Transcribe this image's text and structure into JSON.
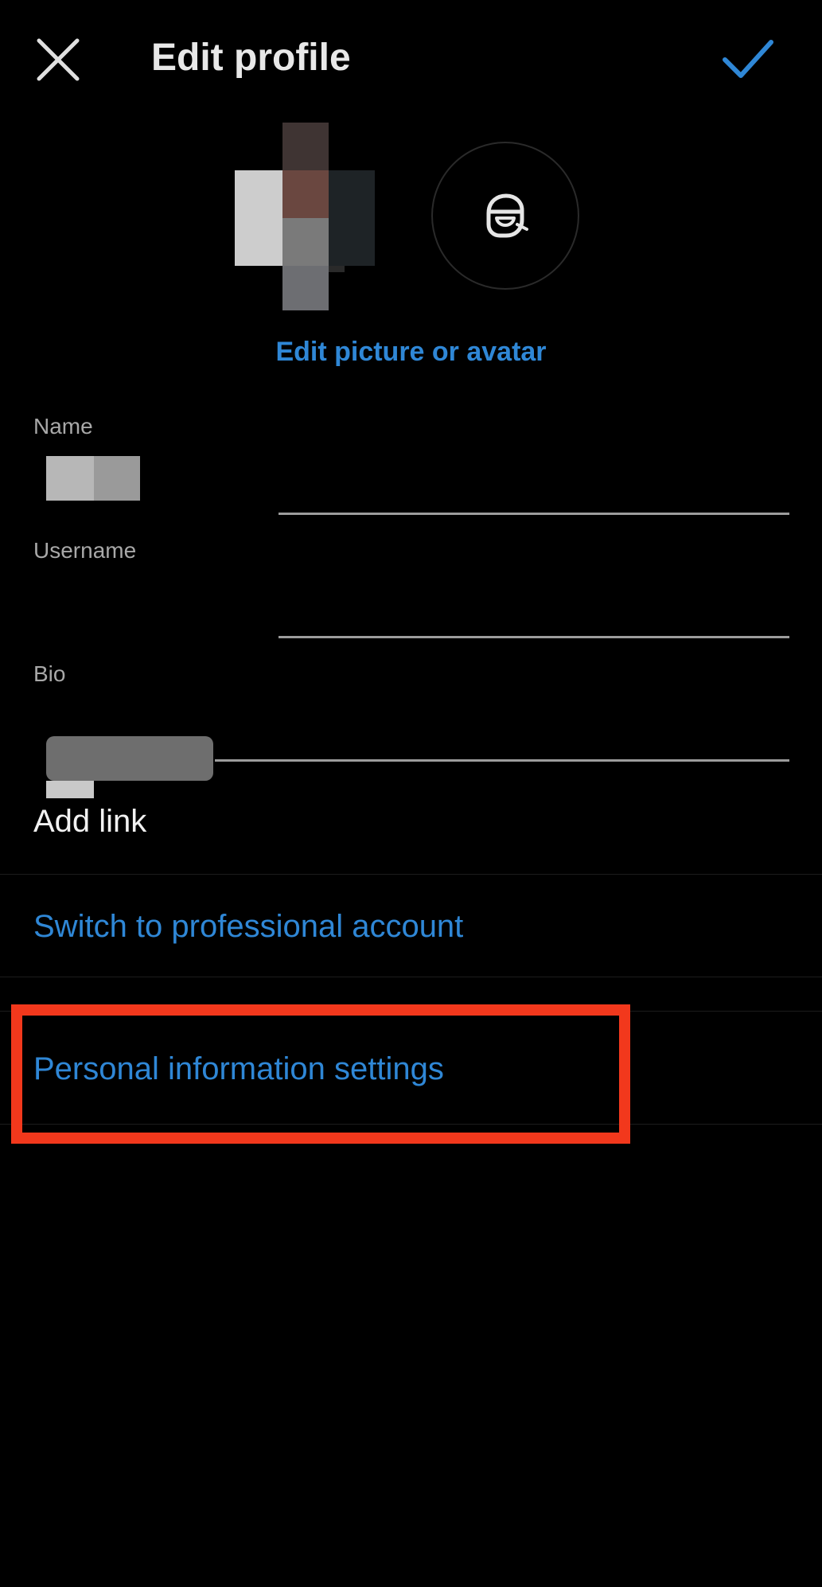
{
  "header": {
    "title": "Edit profile",
    "close_icon": "close-icon",
    "confirm_icon": "checkmark-icon"
  },
  "profile_picture": {
    "avatar_icon": "avatar-sticker-icon",
    "edit_link": "Edit picture or avatar"
  },
  "fields": {
    "name_label": "Name",
    "username_label": "Username",
    "bio_label": "Bio"
  },
  "links": {
    "add_link": "Add link",
    "switch_professional": "Switch to professional account",
    "personal_info": "Personal information settings"
  },
  "colors": {
    "background": "#000000",
    "accent_blue": "#2f87d6",
    "highlight_red": "#f2381c",
    "label_gray": "#a8a8a8"
  }
}
